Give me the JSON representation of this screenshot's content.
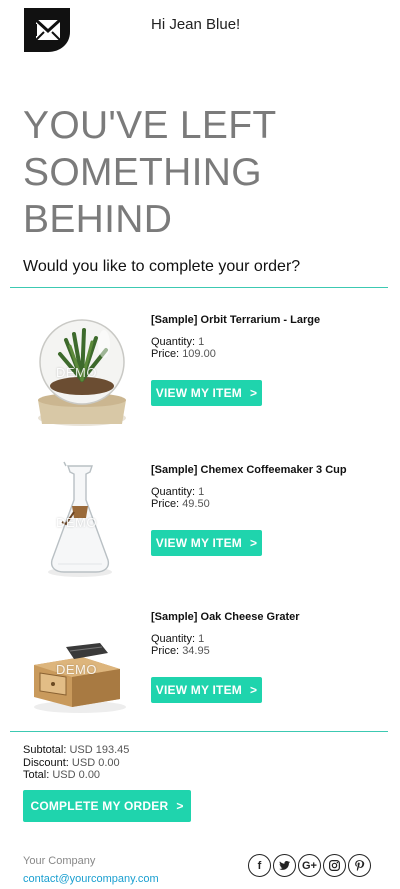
{
  "header": {
    "greeting": "Hi Jean Blue!",
    "logo_icon": "envelope-logo-icon"
  },
  "headline": "YOU'VE LEFT SOMETHING BEHIND",
  "subheading": "Would you like to complete your order?",
  "colors": {
    "accent": "#1fd4ad",
    "divider": "#3cc9b2",
    "headline": "#7b7b7b",
    "link": "#1a9fd0"
  },
  "items": [
    {
      "name": "[Sample] Orbit Terrarium - Large",
      "quantity_label": "Quantity:",
      "quantity": "1",
      "price_label": "Price:",
      "price": "109.00",
      "button": "VIEW MY ITEM",
      "button_icon": ">",
      "watermark": "DEMO"
    },
    {
      "name": "[Sample] Chemex Coffeemaker 3 Cup",
      "quantity_label": "Quantity:",
      "quantity": "1",
      "price_label": "Price:",
      "price": "49.50",
      "button": "VIEW MY ITEM",
      "button_icon": ">",
      "watermark": "DEMO"
    },
    {
      "name": "[Sample] Oak Cheese Grater",
      "quantity_label": "Quantity:",
      "quantity": "1",
      "price_label": "Price:",
      "price": "34.95",
      "button": "VIEW MY ITEM",
      "button_icon": ">",
      "watermark": "DEMO"
    }
  ],
  "totals": {
    "subtotal_label": "Subtotal:",
    "subtotal": "USD 193.45",
    "discount_label": "Discount:",
    "discount": "USD 0.00",
    "total_label": "Total:",
    "total": "USD 0.00"
  },
  "complete_button": {
    "label": "COMPLETE MY ORDER",
    "icon": ">"
  },
  "footer": {
    "company": "Your Company",
    "email": "contact@yourcompany.com",
    "socials": [
      {
        "name": "facebook-icon",
        "glyph": "f"
      },
      {
        "name": "twitter-icon",
        "glyph": ""
      },
      {
        "name": "google-plus-icon",
        "glyph": "G+"
      },
      {
        "name": "instagram-icon",
        "glyph": ""
      },
      {
        "name": "pinterest-icon",
        "glyph": ""
      }
    ]
  }
}
